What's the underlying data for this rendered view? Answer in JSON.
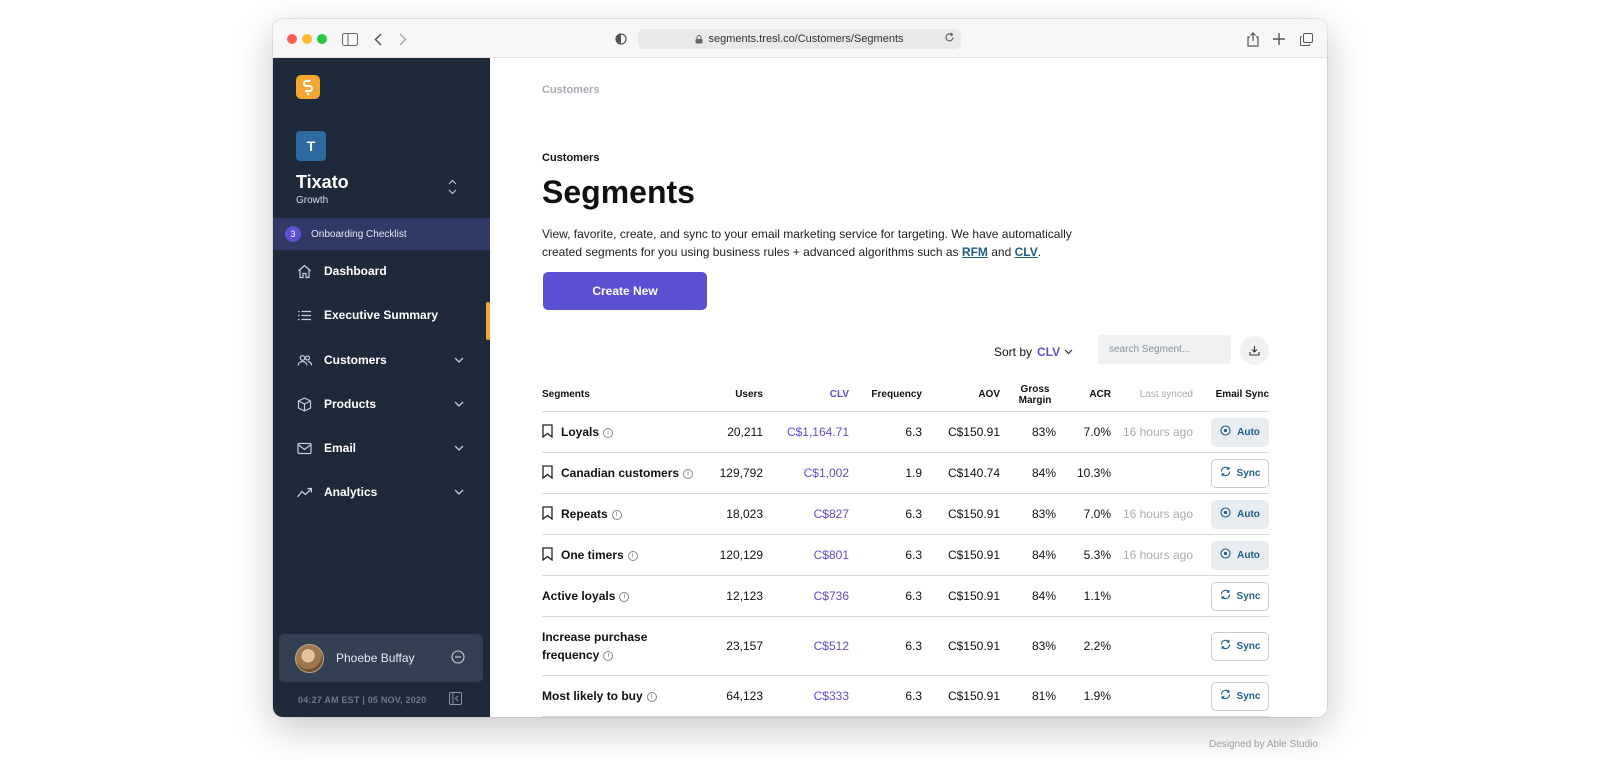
{
  "browser": {
    "url": "segments.tresl.co/Customers/Segments"
  },
  "sidebar": {
    "org_initial": "T",
    "org_name": "Tixato",
    "org_plan": "Growth",
    "onboarding_count": "3",
    "onboarding_label": "Onboarding Checklist",
    "items": [
      {
        "label": "Dashboard",
        "icon": "home-icon"
      },
      {
        "label": "Executive Summary",
        "icon": "list-icon"
      },
      {
        "label": "Customers",
        "icon": "users-icon"
      },
      {
        "label": "Products",
        "icon": "box-icon"
      },
      {
        "label": "Email",
        "icon": "mail-icon"
      },
      {
        "label": "Analytics",
        "icon": "trend-icon"
      }
    ],
    "user_name": "Phoebe Buffay",
    "footer_time": "04:27 AM EST  |  05 NOV, 2020"
  },
  "main": {
    "breadcrumb": "Customers",
    "eyebrow": "Customers",
    "title": "Segments",
    "description_pre": "View, favorite, create, and sync to your email marketing service for targeting. We have automatically created segments for you using business rules + advanced algorithms such as ",
    "rfm_link": "RFM",
    "and_text": " and ",
    "clv_link": "CLV",
    "period": ".",
    "create_button": "Create New",
    "sort_label": "Sort by",
    "sort_value": "CLV",
    "search_placeholder": "search Segment..."
  },
  "table": {
    "headers": {
      "segments": "Segments",
      "users": "Users",
      "clv": "CLV",
      "frequency": "Frequency",
      "aov": "AOV",
      "gross_margin": "Gross Margin",
      "acr": "ACR",
      "last_synced": "Last synced",
      "email_sync": "Email Sync"
    },
    "rows": [
      {
        "name": "Loyals",
        "bookmark": true,
        "users": "20,211",
        "clv": "C$1,164.71",
        "frequency": "6.3",
        "aov": "C$150.91",
        "gm": "83%",
        "acr": "7.0%",
        "last": "16 hours ago",
        "sync": "Auto"
      },
      {
        "name": "Canadian customers",
        "bookmark": true,
        "users": "129,792",
        "clv": "C$1,002",
        "frequency": "1.9",
        "aov": "C$140.74",
        "gm": "84%",
        "acr": "10.3%",
        "last": "",
        "sync": "Sync"
      },
      {
        "name": "Repeats",
        "bookmark": true,
        "users": "18,023",
        "clv": "C$827",
        "frequency": "6.3",
        "aov": "C$150.91",
        "gm": "83%",
        "acr": "7.0%",
        "last": "16 hours ago",
        "sync": "Auto"
      },
      {
        "name": "One timers",
        "bookmark": true,
        "users": "120,129",
        "clv": "C$801",
        "frequency": "6.3",
        "aov": "C$150.91",
        "gm": "84%",
        "acr": "5.3%",
        "last": "16 hours ago",
        "sync": "Auto"
      },
      {
        "name": "Active loyals",
        "bookmark": false,
        "users": "12,123",
        "clv": "C$736",
        "frequency": "6.3",
        "aov": "C$150.91",
        "gm": "84%",
        "acr": "1.1%",
        "last": "",
        "sync": "Sync"
      },
      {
        "name": "Increase purchase frequency",
        "bookmark": false,
        "users": "23,157",
        "clv": "C$512",
        "frequency": "6.3",
        "aov": "C$150.91",
        "gm": "83%",
        "acr": "2.2%",
        "last": "",
        "sync": "Sync"
      },
      {
        "name": "Most likely to buy",
        "bookmark": false,
        "users": "64,123",
        "clv": "C$333",
        "frequency": "6.3",
        "aov": "C$150.91",
        "gm": "81%",
        "acr": "1.9%",
        "last": "",
        "sync": "Sync"
      }
    ]
  },
  "credit": "Designed by Able Studio",
  "colors": {
    "sidebar_bg": "#1e2a39",
    "accent": "#5b4fd3",
    "brand_orange": "#f7a531",
    "link_blue": "#1f5f87"
  }
}
